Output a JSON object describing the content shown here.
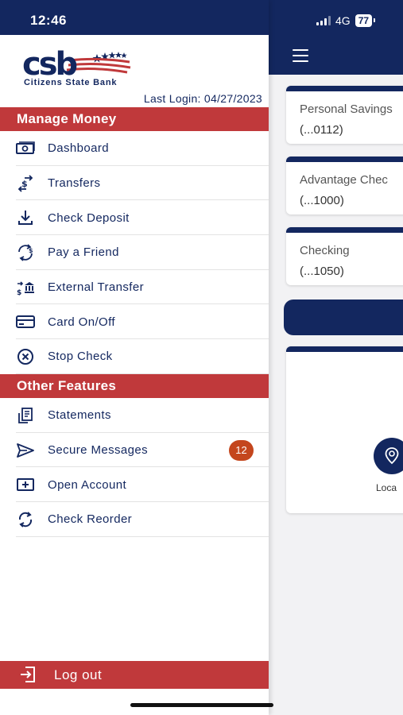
{
  "status_bar": {
    "time": "12:46",
    "network": "4G",
    "battery": "77"
  },
  "brand": {
    "logo_letters": "csb",
    "name": "Citizens State Bank",
    "navy": "#13275f",
    "red": "#c0393b"
  },
  "last_login": {
    "label": "Last Login:",
    "date": "04/27/2023"
  },
  "sections": {
    "manage_money": "Manage Money",
    "other_features": "Other Features"
  },
  "manage_money_items": [
    {
      "label": "Dashboard",
      "icon": "cash-icon"
    },
    {
      "label": "Transfers",
      "icon": "transfer-dollar-icon"
    },
    {
      "label": "Check Deposit",
      "icon": "download-tray-icon"
    },
    {
      "label": "Pay a Friend",
      "icon": "dollar-cycle-icon"
    },
    {
      "label": "External Transfer",
      "icon": "bank-transfer-icon"
    },
    {
      "label": "Card On/Off",
      "icon": "card-icon"
    },
    {
      "label": "Stop Check",
      "icon": "cancel-circle-icon"
    }
  ],
  "other_features_items": [
    {
      "label": "Statements",
      "icon": "statement-icon"
    },
    {
      "label": "Secure Messages",
      "icon": "send-icon",
      "badge": "12"
    },
    {
      "label": "Open Account",
      "icon": "open-account-icon"
    },
    {
      "label": "Check Reorder",
      "icon": "reorder-icon"
    }
  ],
  "logout_label": "Log out",
  "accounts": [
    {
      "name": "Personal Savings",
      "number": "(...0112)"
    },
    {
      "name": "Advantage Chec",
      "number": "(...1000)"
    },
    {
      "name": "Checking",
      "number": "(...1050)"
    }
  ],
  "locate_label": "Loca"
}
